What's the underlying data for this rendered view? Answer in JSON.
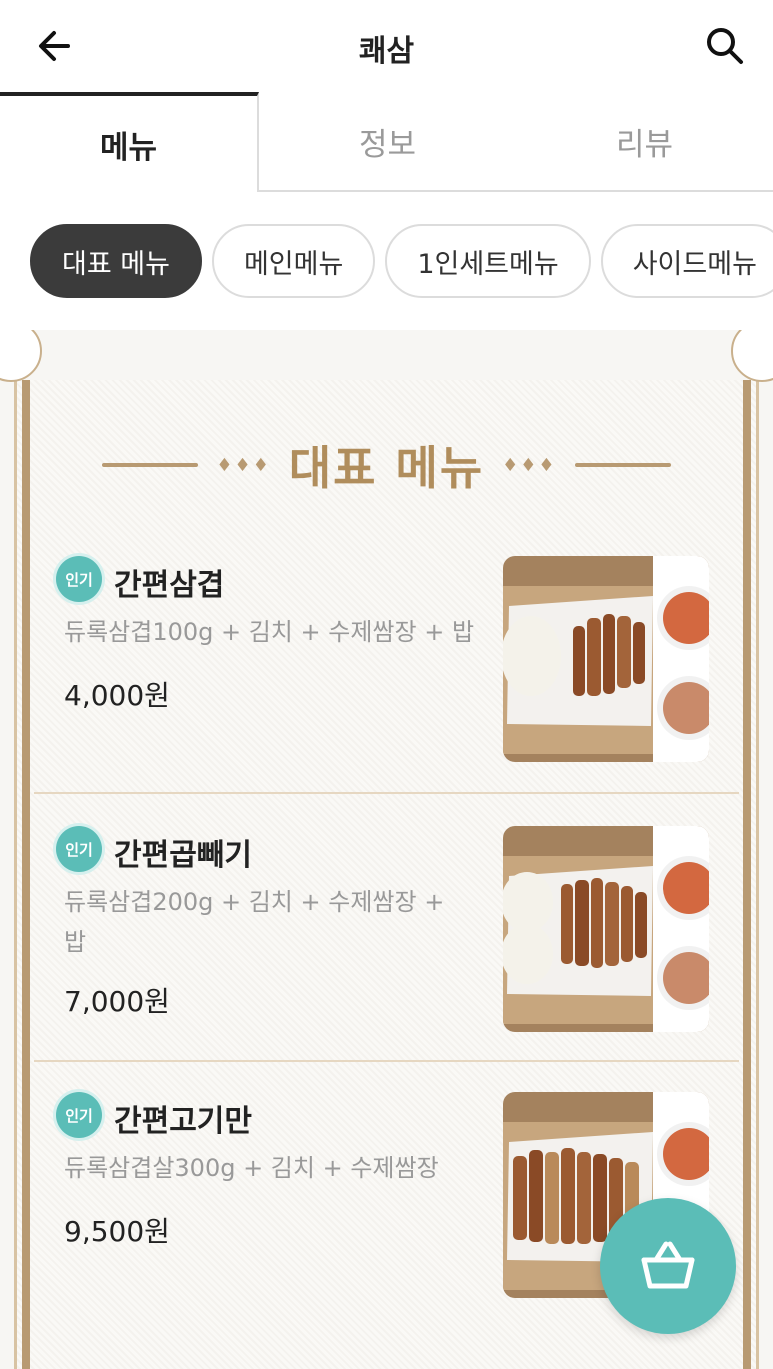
{
  "header": {
    "title": "쾌삼"
  },
  "tabs": [
    {
      "label": "메뉴",
      "active": true
    },
    {
      "label": "정보",
      "active": false
    },
    {
      "label": "리뷰",
      "active": false
    }
  ],
  "chips": [
    {
      "label": "대표 메뉴",
      "active": true
    },
    {
      "label": "메인메뉴",
      "active": false
    },
    {
      "label": "1인세트메뉴",
      "active": false
    },
    {
      "label": "사이드메뉴",
      "active": false
    }
  ],
  "section": {
    "title": "대표 메뉴",
    "decoration": "♦♦♦"
  },
  "items": [
    {
      "badge": "인기",
      "name": "간편삼겹",
      "description": "듀록삼겹100g + 김치 + 수제쌈장 + 밥",
      "price": "4,000원"
    },
    {
      "badge": "인기",
      "name": "간편곱빼기",
      "description": "듀록삼겹200g + 김치 + 수제쌈장 + 밥",
      "price": "7,000원"
    },
    {
      "badge": "인기",
      "name": "간편고기만",
      "description": "듀록삼겹살300g + 김치 + 수제쌈장",
      "price": "9,500원"
    }
  ],
  "colors": {
    "accent": "#5bbdb7",
    "gold": "#b08d5c",
    "dark_chip": "#3b3b3b"
  },
  "icons": {
    "back": "arrow-left-icon",
    "search": "search-icon",
    "cart": "basket-icon"
  }
}
